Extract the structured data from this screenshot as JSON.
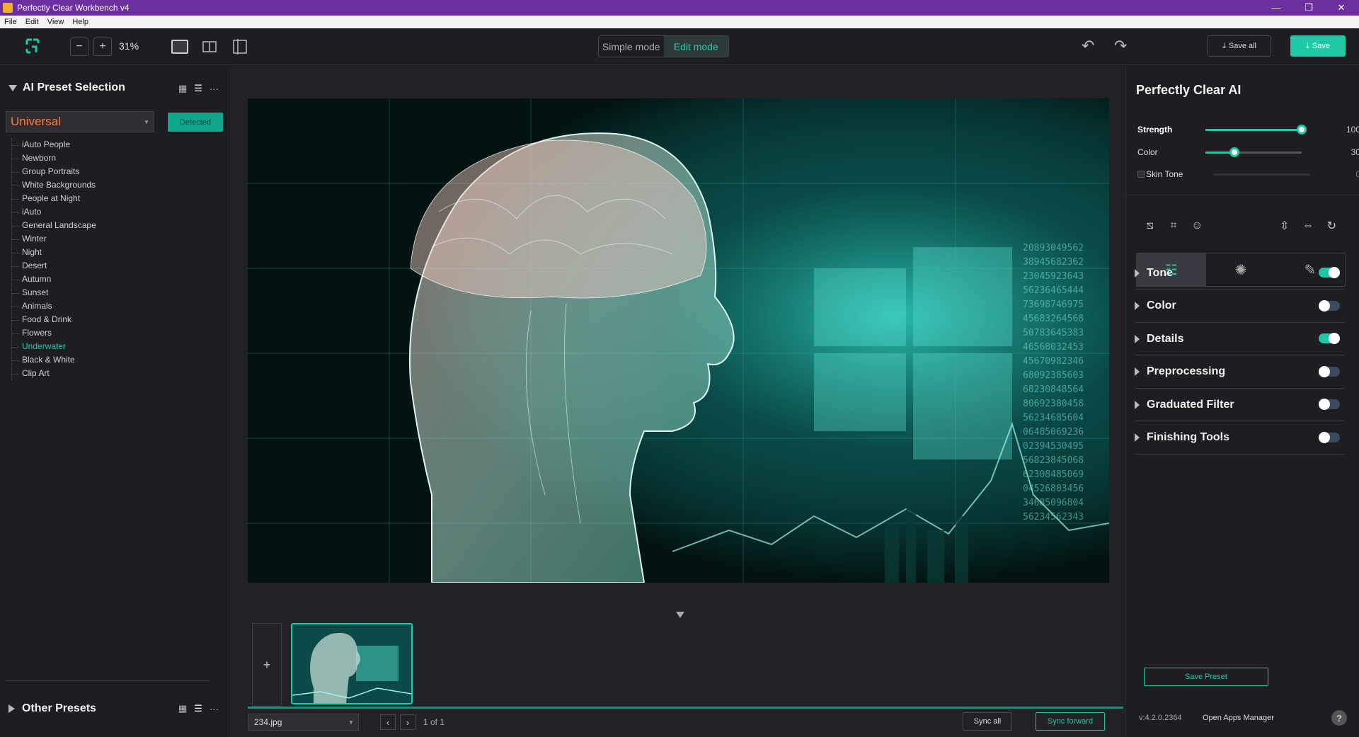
{
  "titlebar": {
    "title": "Perfectly Clear Workbench v4",
    "minimize": "—",
    "maximize": "❐",
    "close": "✕"
  },
  "menu": [
    "File",
    "Edit",
    "View",
    "Help"
  ],
  "toolbar": {
    "zoom_out": "−",
    "zoom_in": "+",
    "zoom": "31%",
    "simple_mode": "Simple mode",
    "edit_mode": "Edit mode",
    "undo": "↶",
    "redo": "↷",
    "save_all": "Save all",
    "save": "Save"
  },
  "left": {
    "title": "AI Preset Selection",
    "preset_select": "Universal",
    "detected": "Detected",
    "more": "···",
    "presets": [
      "iAuto People",
      "Newborn",
      "Group Portraits",
      "White Backgrounds",
      "People at Night",
      "iAuto",
      "General Landscape",
      "Winter",
      "Night",
      "Desert",
      "Autumn",
      "Sunset",
      "Animals",
      "Food & Drink",
      "Flowers",
      "Underwater",
      "Black & White",
      "Clip Art"
    ],
    "active_preset": "Underwater",
    "other_presets": "Other Presets"
  },
  "filmstrip": {
    "add": "+",
    "file": "234.jpg",
    "prev": "‹",
    "next": "›",
    "page": "1 of 1",
    "sync_all": "Sync all",
    "sync_forward": "Sync forward"
  },
  "right": {
    "title": "Perfectly Clear AI",
    "sliders": [
      {
        "label": "Strength",
        "value": "100",
        "level": 100,
        "bold": true
      },
      {
        "label": "Color",
        "value": "30",
        "level": 30,
        "bold": false
      }
    ],
    "skin_tone": {
      "label": "Skin Tone",
      "value": "0"
    },
    "sections": [
      {
        "name": "Tone",
        "on": true
      },
      {
        "name": "Color",
        "on": false
      },
      {
        "name": "Details",
        "on": true
      },
      {
        "name": "Preprocessing",
        "on": false
      },
      {
        "name": "Graduated Filter",
        "on": false
      },
      {
        "name": "Finishing Tools",
        "on": false
      }
    ],
    "save_preset": "Save Preset",
    "version": "v:4.2.0.2364",
    "apps_manager": "Open Apps Manager",
    "help": "?"
  },
  "colors": {
    "accent": "#1fc9a6",
    "title_bar": "#6b2fa0",
    "preset_orange": "#ff7a3c"
  }
}
